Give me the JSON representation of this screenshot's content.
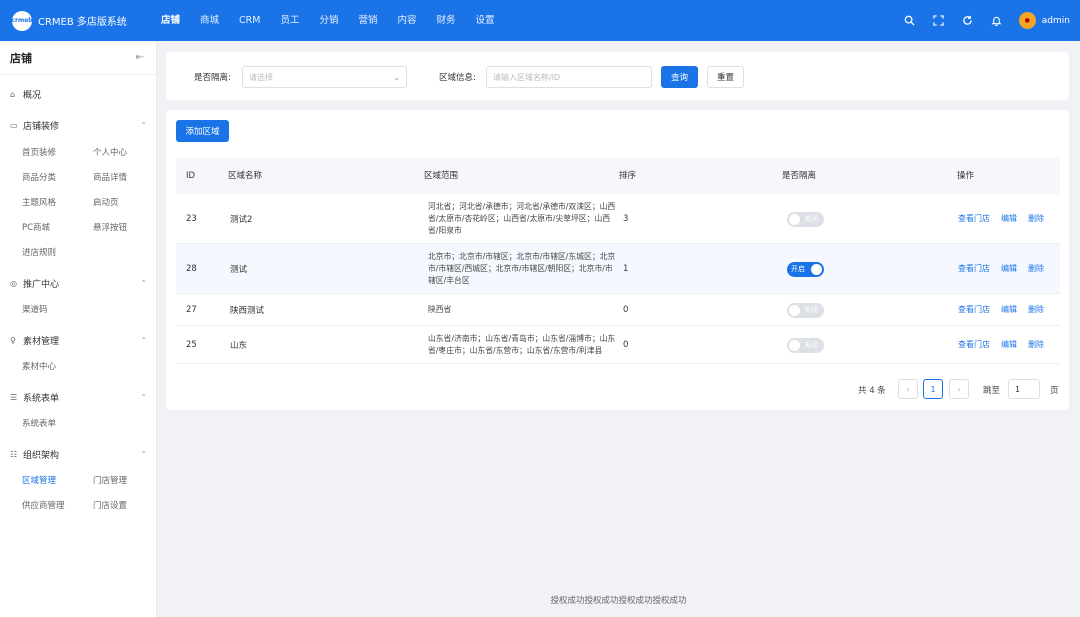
{
  "app": {
    "logo_text": "crmeb",
    "title": "CRMEB 多店版系统",
    "brand_color": "#1b73e8"
  },
  "nav": [
    "店铺",
    "商城",
    "CRM",
    "员工",
    "分销",
    "营销",
    "内容",
    "财务",
    "设置"
  ],
  "active_nav": "店铺",
  "user": {
    "name": "admin"
  },
  "top_icons": [
    "search-icon",
    "fullscreen-icon",
    "refresh-icon",
    "bell-icon"
  ],
  "sidebar": {
    "title": "店铺",
    "overview": "概况",
    "groups": [
      {
        "label": "店铺装修",
        "icon": "layout-icon",
        "items": [
          "首页装修",
          "个人中心",
          "商品分类",
          "商品详情",
          "主题风格",
          "启动页",
          "PC商城",
          "悬浮按钮",
          "进店规则"
        ]
      },
      {
        "label": "推广中心",
        "icon": "promote-icon",
        "items": [
          "渠道码"
        ]
      },
      {
        "label": "素材管理",
        "icon": "material-icon",
        "items": [
          "素材中心"
        ]
      },
      {
        "label": "系统表单",
        "icon": "form-icon",
        "items": [
          "系统表单"
        ]
      },
      {
        "label": "组织架构",
        "icon": "org-icon",
        "items": [
          "区域管理",
          "门店管理",
          "供应商管理",
          "门店设置"
        ]
      }
    ],
    "active_item": "区域管理"
  },
  "filter": {
    "isolate_label": "是否隔离:",
    "isolate_placeholder": "请选择",
    "region_label": "区域信息:",
    "region_placeholder": "请输入区域名称/ID",
    "query_button": "查询",
    "reset_button": "重置"
  },
  "table": {
    "add_button": "添加区域",
    "columns": [
      "ID",
      "区域名称",
      "区域范围",
      "排序",
      "是否隔离",
      "操作"
    ],
    "rows": [
      {
        "id": "23",
        "name": "测试2",
        "range": "河北省；河北省/承德市；河北省/承德市/双滦区；山西省/太原市/杏花岭区；山西省/太原市/尖草坪区；山西省/阳泉市",
        "sort": "3",
        "isolated": false
      },
      {
        "id": "28",
        "name": "测试",
        "range": "北京市；北京市/市辖区；北京市/市辖区/东城区；北京市/市辖区/西城区；北京市/市辖区/朝阳区；北京市/市辖区/丰台区",
        "sort": "1",
        "isolated": true
      },
      {
        "id": "27",
        "name": "陕西测试",
        "range": "陕西省",
        "sort": "0",
        "isolated": false
      },
      {
        "id": "25",
        "name": "山东",
        "range": "山东省/济南市；山东省/青岛市；山东省/淄博市；山东省/枣庄市；山东省/东营市；山东省/东营市/利津县",
        "sort": "0",
        "isolated": false
      }
    ],
    "switch_on": "开启",
    "switch_off": "关闭",
    "actions": [
      "查看门店",
      "编辑",
      "删除"
    ]
  },
  "pagination": {
    "total_text": "共 4 条",
    "current_page": "1",
    "jump_label": "跳至",
    "jump_value": "1",
    "page_suffix": "页"
  },
  "footer": "授权成功授权成功授权成功授权成功"
}
